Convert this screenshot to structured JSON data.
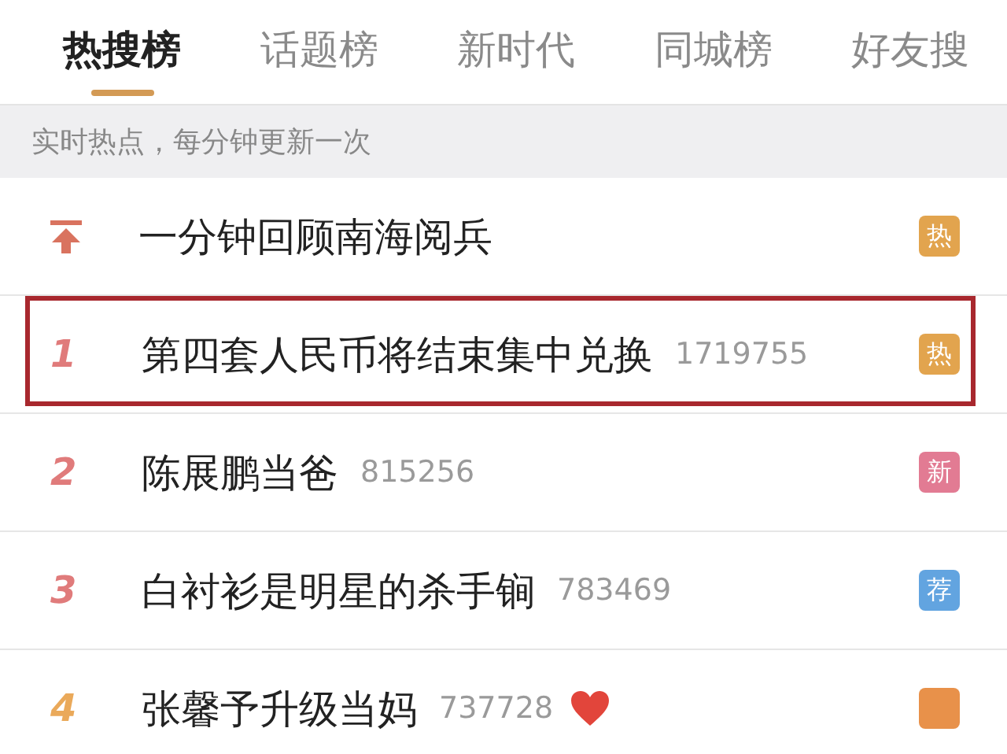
{
  "tabs": [
    {
      "label": "热搜榜",
      "selected": true
    },
    {
      "label": "话题榜",
      "selected": false
    },
    {
      "label": "新时代",
      "selected": false
    },
    {
      "label": "同城榜",
      "selected": false
    },
    {
      "label": "好友搜",
      "selected": false
    }
  ],
  "notice": "实时热点，每分钟更新一次",
  "items": [
    {
      "kind": "pinned",
      "title": "一分钟回顾南海阅兵",
      "badge": {
        "label": "热",
        "color": "#e2a44e"
      }
    },
    {
      "kind": "ranked",
      "rank": "1",
      "color": "#e07b7b",
      "title": "第四套人民币将结束集中兑换",
      "count": "1719755",
      "highlighted": true,
      "badge": {
        "label": "热",
        "color": "#e2a44e"
      }
    },
    {
      "kind": "ranked",
      "rank": "2",
      "color": "#e07b7b",
      "title": "陈展鹏当爸",
      "count": "815256",
      "badge": {
        "label": "新",
        "color": "#e27b93"
      }
    },
    {
      "kind": "ranked",
      "rank": "3",
      "color": "#e07b7b",
      "title": "白衬衫是明星的杀手锏",
      "count": "783469",
      "badge": {
        "label": "荐",
        "color": "#62a4e0"
      }
    },
    {
      "kind": "ranked",
      "rank": "4",
      "color": "#eaa95a",
      "title": "张馨予升级当妈",
      "count": "737728",
      "heart": true,
      "badge": {
        "color": "#e8914a"
      }
    }
  ]
}
